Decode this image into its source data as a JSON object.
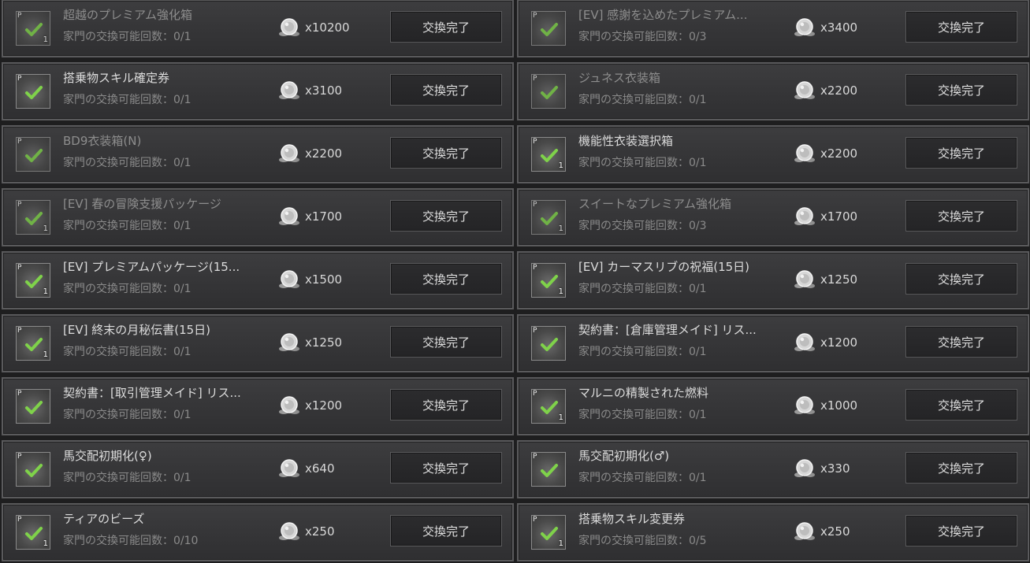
{
  "colors": {
    "check_green": "#7fd24a",
    "button_bg": "#262628",
    "row_bg": "#38383a"
  },
  "icons": {
    "coin": "silver-coin-icon",
    "check": "checkmark-icon"
  },
  "items": [
    {
      "name": "超越のプレミアム強化箱",
      "count_label": "家門の交換可能回数：0/1",
      "price": "x10200",
      "button": "交換完了",
      "badge": "1",
      "muted": true
    },
    {
      "name": "[EV] 感謝を込めたプレミアム...",
      "count_label": "家門の交換可能回数：0/3",
      "price": "x3400",
      "button": "交換完了",
      "badge": "",
      "muted": true
    },
    {
      "name": "搭乗物スキル確定券",
      "count_label": "家門の交換可能回数：0/1",
      "price": "x3100",
      "button": "交換完了",
      "badge": "",
      "muted": false
    },
    {
      "name": "ジュネス衣装箱",
      "count_label": "家門の交換可能回数：0/1",
      "price": "x2200",
      "button": "交換完了",
      "badge": "",
      "muted": true
    },
    {
      "name": "BD9衣装箱(N)",
      "count_label": "家門の交換可能回数：0/1",
      "price": "x2200",
      "button": "交換完了",
      "badge": "",
      "muted": true
    },
    {
      "name": "機能性衣装選択箱",
      "count_label": "家門の交換可能回数：0/1",
      "price": "x2200",
      "button": "交換完了",
      "badge": "1",
      "muted": false
    },
    {
      "name": "[EV] 春の冒険支援パッケージ",
      "count_label": "家門の交換可能回数：0/1",
      "price": "x1700",
      "button": "交換完了",
      "badge": "1",
      "muted": true
    },
    {
      "name": "スイートなプレミアム強化箱",
      "count_label": "家門の交換可能回数：0/3",
      "price": "x1700",
      "button": "交換完了",
      "badge": "1",
      "muted": true
    },
    {
      "name": "[EV] プレミアムパッケージ(15...",
      "count_label": "家門の交換可能回数：0/1",
      "price": "x1500",
      "button": "交換完了",
      "badge": "1",
      "muted": false
    },
    {
      "name": "[EV] カーマスリブの祝福(15日)",
      "count_label": "家門の交換可能回数：0/1",
      "price": "x1250",
      "button": "交換完了",
      "badge": "1",
      "muted": false
    },
    {
      "name": "[EV] 終末の月秘伝書(15日)",
      "count_label": "家門の交換可能回数：0/1",
      "price": "x1250",
      "button": "交換完了",
      "badge": "1",
      "muted": false
    },
    {
      "name": "契約書：[倉庫管理メイド] リス...",
      "count_label": "家門の交換可能回数：0/1",
      "price": "x1200",
      "button": "交換完了",
      "badge": "",
      "muted": false
    },
    {
      "name": "契約書：[取引管理メイド] リス...",
      "count_label": "家門の交換可能回数：0/1",
      "price": "x1200",
      "button": "交換完了",
      "badge": "",
      "muted": false
    },
    {
      "name": "マルニの精製された燃料",
      "count_label": "家門の交換可能回数：0/1",
      "price": "x1000",
      "button": "交換完了",
      "badge": "1",
      "muted": false
    },
    {
      "name": "馬交配初期化(♀)",
      "count_label": "家門の交換可能回数：0/1",
      "price": "x640",
      "button": "交換完了",
      "badge": "",
      "muted": false
    },
    {
      "name": "馬交配初期化(♂)",
      "count_label": "家門の交換可能回数：0/1",
      "price": "x330",
      "button": "交換完了",
      "badge": "",
      "muted": false
    },
    {
      "name": "ティアのビーズ",
      "count_label": "家門の交換可能回数：0/10",
      "price": "x250",
      "button": "交換完了",
      "badge": "1",
      "muted": false
    },
    {
      "name": "搭乗物スキル変更券",
      "count_label": "家門の交換可能回数：0/5",
      "price": "x250",
      "button": "交換完了",
      "badge": "1",
      "muted": false
    }
  ]
}
